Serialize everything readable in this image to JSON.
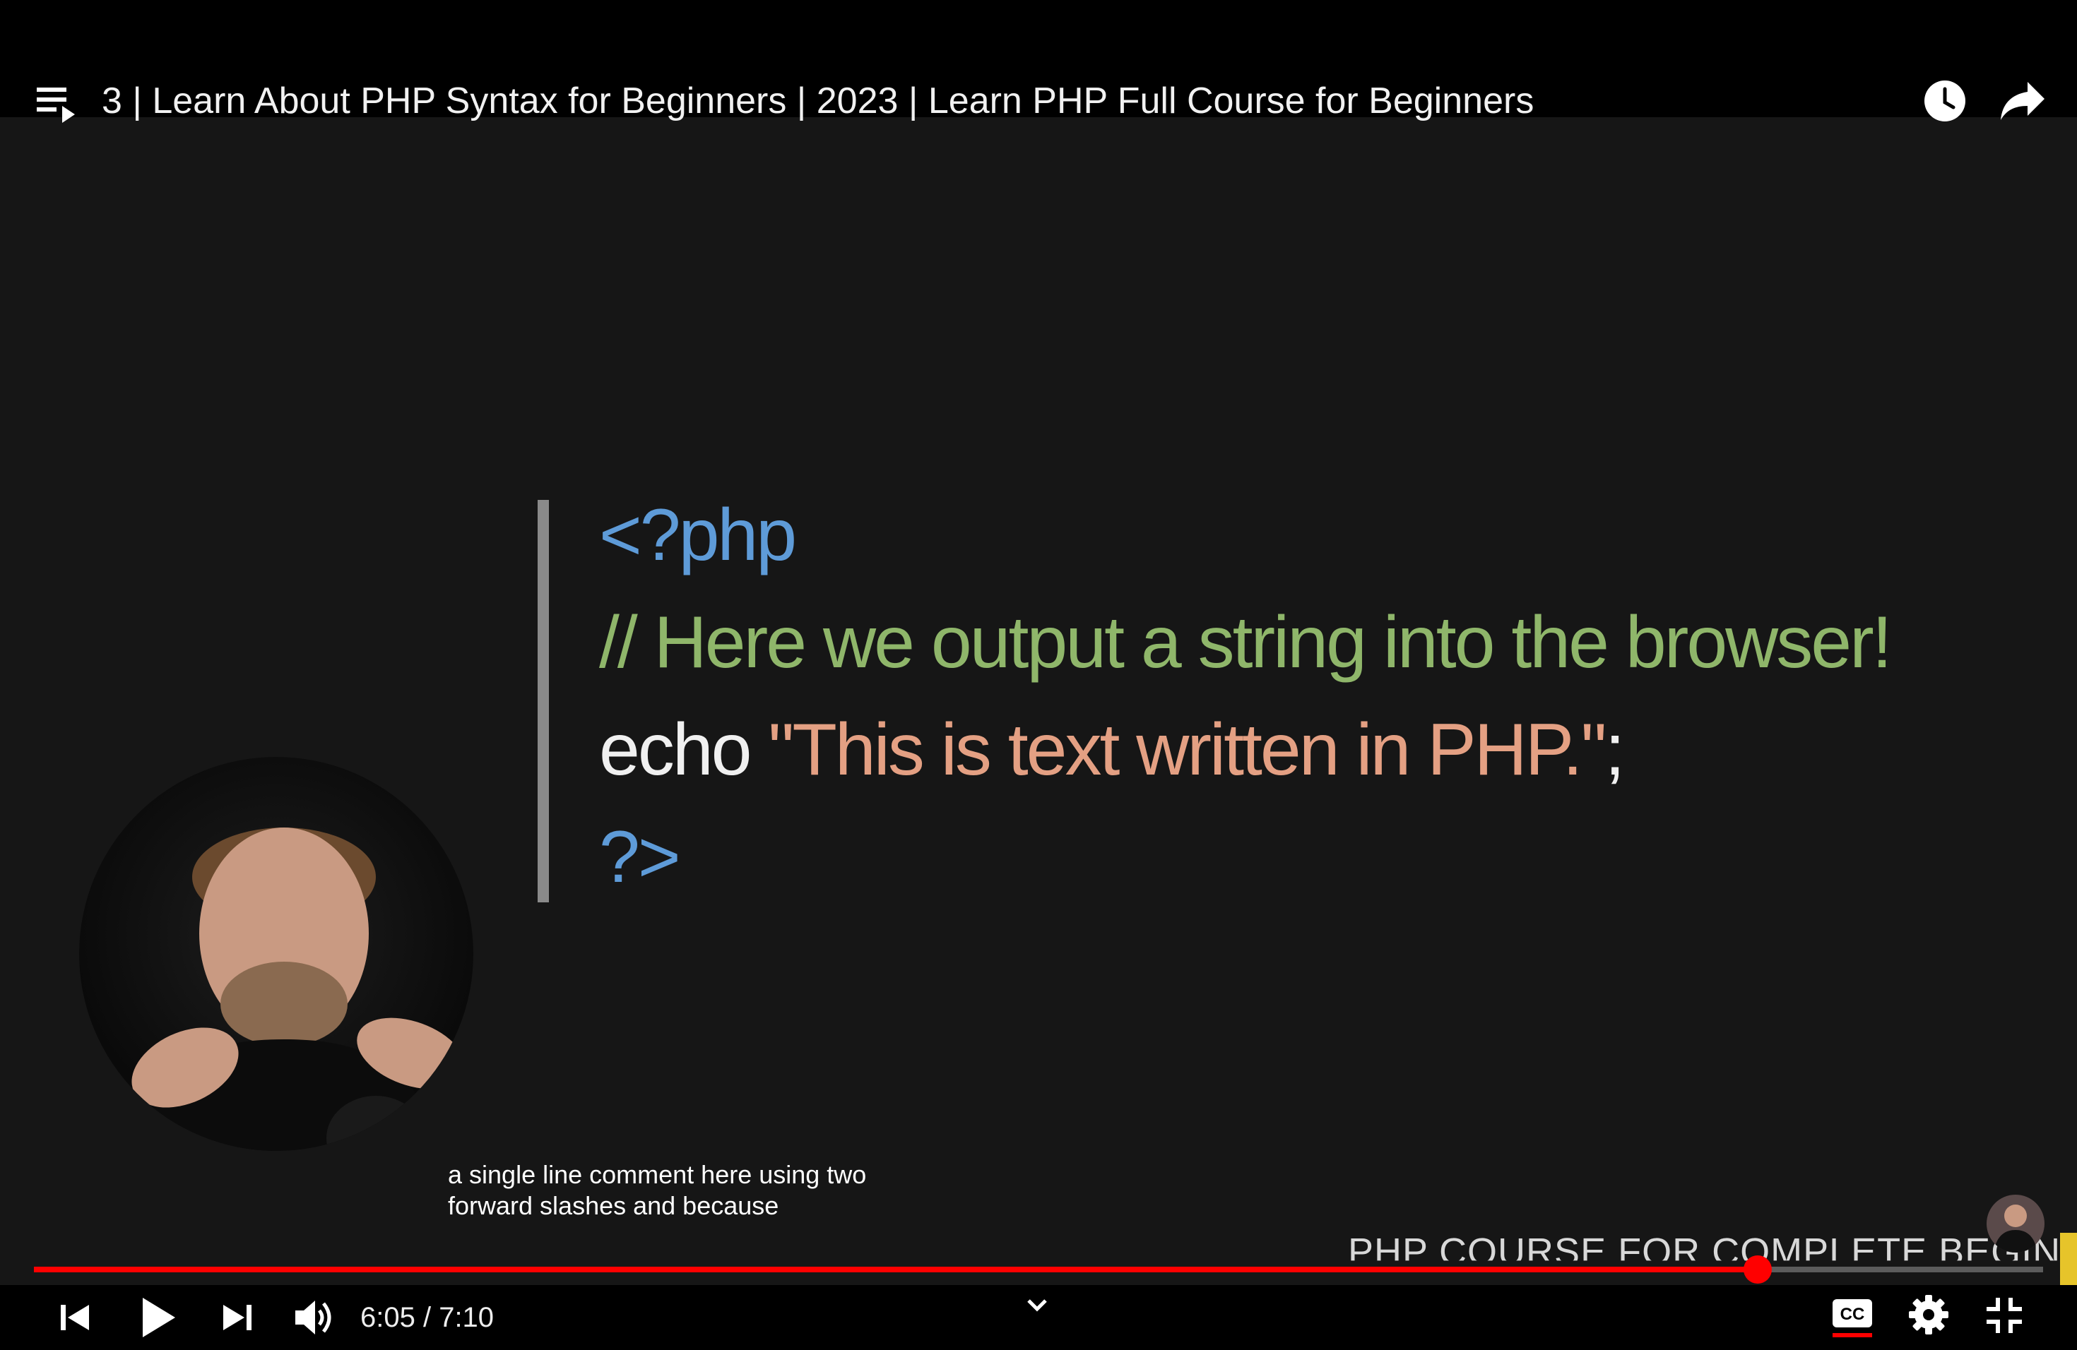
{
  "video": {
    "title": "3 | Learn About PHP Syntax for Beginners | 2023 | Learn PHP Full Course for Beginners"
  },
  "slide": {
    "line1": "<?php",
    "line2": "// Here we output a string into the browser!",
    "line3_keyword": "echo ",
    "line3_string": "\"This is text written in PHP.\"",
    "line3_end": ";",
    "line4": "?>"
  },
  "captions": {
    "line1": "a single line comment here using two",
    "line2": "forward slashes and because"
  },
  "branding": {
    "lower_third": "PHP COURSE FOR COMPLETE BEGINNERS"
  },
  "player": {
    "time_display": "6:05 / 7:10",
    "progress_fraction": 0.8578
  },
  "icons": {
    "playlist": "playlist-icon",
    "watch_later": "clock-icon",
    "share": "share-icon",
    "previous": "skip-previous-icon",
    "play": "play-icon",
    "next": "skip-next-icon",
    "volume": "volume-icon",
    "expand": "chevron-down-icon",
    "captions": "cc-icon",
    "settings": "gear-icon",
    "exit_fullscreen": "exit-fullscreen-icon"
  },
  "colors": {
    "accent": "#ff0000",
    "php_tag": "#5e9bd8",
    "comment": "#8fb66a",
    "string": "#e4a083"
  }
}
